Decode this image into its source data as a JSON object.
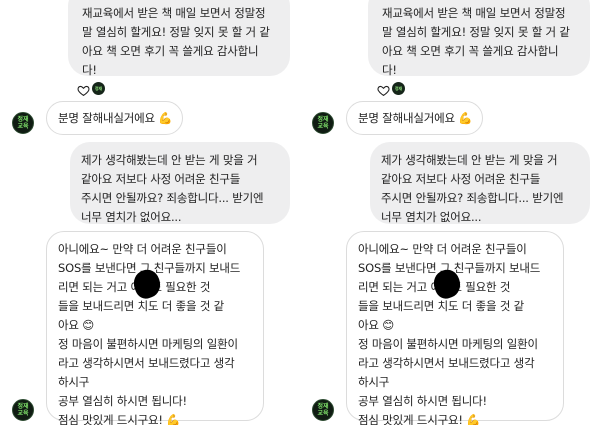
{
  "panels": [
    {
      "id": "left",
      "received_message_lines": [
        "재교육에서 받은 책 매일 보면서 정말정",
        "말 열심히 할게요! 정말 잊지 못 할 거 같",
        "아요 책 오면 후기 꼭 쓸게요 감사합니",
        "다!"
      ],
      "reply_short": "분명 잘해내실거에요 💪",
      "received_message2_lines": [
        "제가 생각해봤는데 안 받는 게 맞을 거",
        "같아요 저보다 사정 어려운 친구들 ",
        "주시면 안될까요? 죄송합니다... 받기엔",
        "너무 염치가 없어요..."
      ],
      "reply_long_lines": [
        "아니에요~ 만약 더 어려운 친구들이",
        "SOS를 보낸다면 그 친구들까지 보내드",
        "리면 되는 거고      에게도 필요한 것",
        "들을 보내드리면      치도 더 좋을 것 같",
        "아요 😊",
        "정 마음이 불편하시면 마케팅의 일환이",
        "라고 생각하시면서 보내드렸다고 생각",
        "하시구",
        "공부 열심히 하시면 됩니다!",
        "점심 맛있게 드시구요! 💪"
      ]
    },
    {
      "id": "right",
      "received_message_lines": [
        "재교육에서 받은 책 매일 보면서 정말정",
        "말 열심히 할게요! 정말 잊지 못 할 거 같",
        "아요 책 오면 후기 꼭 쓸게요 감사합니",
        "다!"
      ],
      "reply_short": "분명 잘해내실거에요 💪",
      "received_message2_lines": [
        "제가 생각해봤는데 안 받는 게 맞을 거",
        "같아요 저보다 사정 어려운 친구들 ",
        "주시면 안될까요? 죄송합니다... 받기엔",
        "너무 염치가 없어요..."
      ],
      "reply_long_lines": [
        "아니에요~ 만약 더 어려운 친구들이",
        "SOS를 보낸다면 그 친구들까지 보내드",
        "리면 되는 거고      에게도 필요한 것",
        "들을 보내드리면      치도 더 좋을 것 같",
        "아요 😊",
        "정 마음이 불편하시면 마케팅의 일환이",
        "라고 생각하시면서 보내드렸다고 생각",
        "하시구",
        "공부 열심히 하시면 됩니다!",
        "점심 맛있게 드시구요! 💪"
      ]
    }
  ],
  "avatar_text": "정재\n교육",
  "icons": [
    "heart-icon",
    "flexed-biceps-emoji",
    "smiling-face-emoji"
  ],
  "colors": {
    "received_bubble": "#eeeeef",
    "sent_border": "#dcdcdc",
    "avatar_bg": "#101c13",
    "avatar_text": "#7ee06a"
  }
}
